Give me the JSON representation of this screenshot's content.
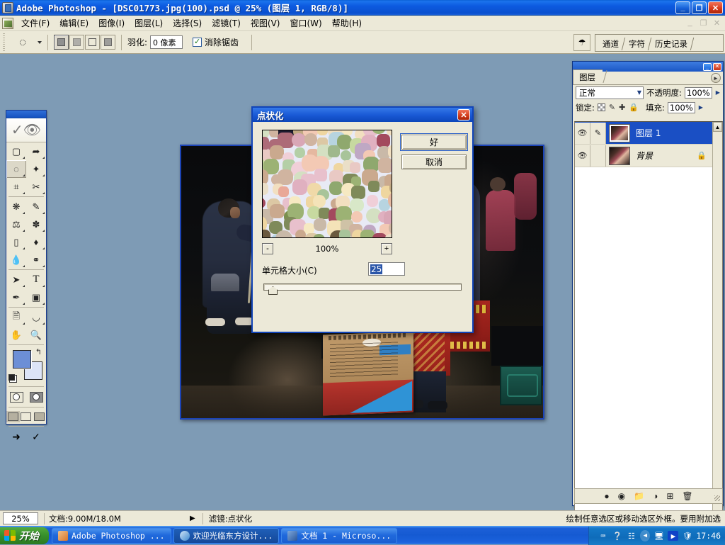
{
  "window": {
    "title": "Adobe Photoshop - [DSC01773.jpg(100).psd @ 25% (图层 1, RGB/8)]",
    "app_icon": "photoshop-icon",
    "minimize": "_",
    "maximize": "❐",
    "close": "✕"
  },
  "menubar": {
    "doc_icon": "document-icon",
    "items": [
      "文件(F)",
      "编辑(E)",
      "图像(I)",
      "图层(L)",
      "选择(S)",
      "滤镜(T)",
      "视图(V)",
      "窗口(W)",
      "帮助(H)"
    ],
    "mdi_minimize": "_",
    "mdi_restore": "❐",
    "mdi_close": "✕"
  },
  "options_bar": {
    "tool_icon": "lasso-icon",
    "tool_dropdown": "chevron-down-icon",
    "selection_modes": [
      "new-selection",
      "add-to-selection",
      "subtract-from-selection",
      "intersect-selection"
    ],
    "feather_label": "羽化:",
    "feather_value": "0 像素",
    "antialias_label": "消除锯齿",
    "antialias_checked": true,
    "dock_icon": "palette-well-icon",
    "well_tabs": [
      "通道",
      "字符",
      "历史记录"
    ]
  },
  "toolbox": {
    "logo": "feather-logo",
    "tools": [
      "marquee-icon",
      "move-icon",
      "lasso-icon",
      "magic-wand-icon",
      "crop-icon",
      "slice-icon",
      "healing-brush-icon",
      "paintbrush-icon",
      "clone-stamp-icon",
      "history-brush-icon",
      "eraser-icon",
      "paint-bucket-icon",
      "blur-icon",
      "dodge-icon",
      "path-selection-icon",
      "type-icon",
      "pen-icon",
      "shape-icon",
      "notes-icon",
      "eyedropper-icon",
      "hand-icon",
      "zoom-icon"
    ],
    "active_tool": "lasso-icon",
    "foreground_color": "#6c8fd6",
    "background_color": "#dce4f7",
    "swap_icon": "swap-colors-icon",
    "default_icon": "default-colors-icon",
    "quickmask": [
      "standard-mode-icon",
      "quickmask-mode-icon"
    ],
    "screenmodes": [
      "standard-screen-icon",
      "fullscreen-menubar-icon",
      "fullscreen-icon"
    ],
    "jump_to": [
      "jump-to-imageready-icon",
      "jump-to-icon"
    ]
  },
  "document": {
    "alt": "DSC01773 dark photo of a crouching man and a person in red robe"
  },
  "layers_panel": {
    "minimize_icon": "_",
    "close_icon": "✕",
    "tab_label": "图层",
    "menu_icon": "palette-menu-icon",
    "blend_mode": "正常",
    "blend_chevron": "▾",
    "opacity_label": "不透明度:",
    "opacity_value": "100%",
    "lock_label": "锁定:",
    "lock_icons": [
      "lock-transparency-icon",
      "lock-image-icon",
      "lock-position-icon",
      "lock-all-icon"
    ],
    "fill_label": "填充:",
    "fill_value": "100%",
    "layers": [
      {
        "name": "图层 1",
        "visible": true,
        "linked": false,
        "active": true,
        "locked": false,
        "brush": "brush-icon",
        "eye": "eye-icon"
      },
      {
        "name": "背景",
        "visible": true,
        "linked": false,
        "active": false,
        "locked": true,
        "brush": "",
        "eye": "eye-icon"
      }
    ],
    "footer_icons": [
      "layer-style-icon",
      "layer-mask-icon",
      "new-group-icon",
      "adjustment-layer-icon",
      "new-layer-icon",
      "delete-layer-icon"
    ],
    "scroll_up": "▲",
    "scroll_down": "▼"
  },
  "dialog": {
    "title": "点状化",
    "close_icon": "✕",
    "ok_label": "好",
    "cancel_label": "取消",
    "zoom_out": "-",
    "zoom_in": "+",
    "zoom_percent": "100%",
    "cell_size_label": "单元格大小(C)",
    "cell_size_value": "25",
    "slider_min": 3,
    "slider_max": 300,
    "preview_background": "#e8eaf5"
  },
  "statusbar": {
    "zoom_value": "25%",
    "doc_info": "文档:9.00M/18.0M",
    "arrow_icon": "play-arrow-icon",
    "filter_info": "滤镜:点状化",
    "hint": "绘制任意选区或移动选区外框。要用附加选"
  },
  "taskbar": {
    "start_label": "开始",
    "start_logo": "windows-logo-icon",
    "tasks": [
      {
        "label": "Adobe Photoshop ...",
        "icon": "photoshop-icon",
        "color": "#d8762a",
        "active": false
      },
      {
        "label": "欢迎光临东方设计...",
        "icon": "ie-icon",
        "color": "#3f8ad0",
        "active": true
      },
      {
        "label": "文档 1 - Microso...",
        "icon": "word-icon",
        "color": "#2b579a",
        "active": false
      }
    ],
    "tray_icons": [
      "keyboard-icon",
      "help-icon",
      "network-icon",
      "media-player-icon",
      "shield-icon"
    ],
    "tray_chevron": "◀",
    "clock": "17:46"
  },
  "colors": {
    "title_blue": "#0d5ae0",
    "chrome": "#ece9d8",
    "desktop": "#7e9bb5",
    "selection_blue": "#1a4fc4",
    "accent_orange": "#d6401f"
  }
}
